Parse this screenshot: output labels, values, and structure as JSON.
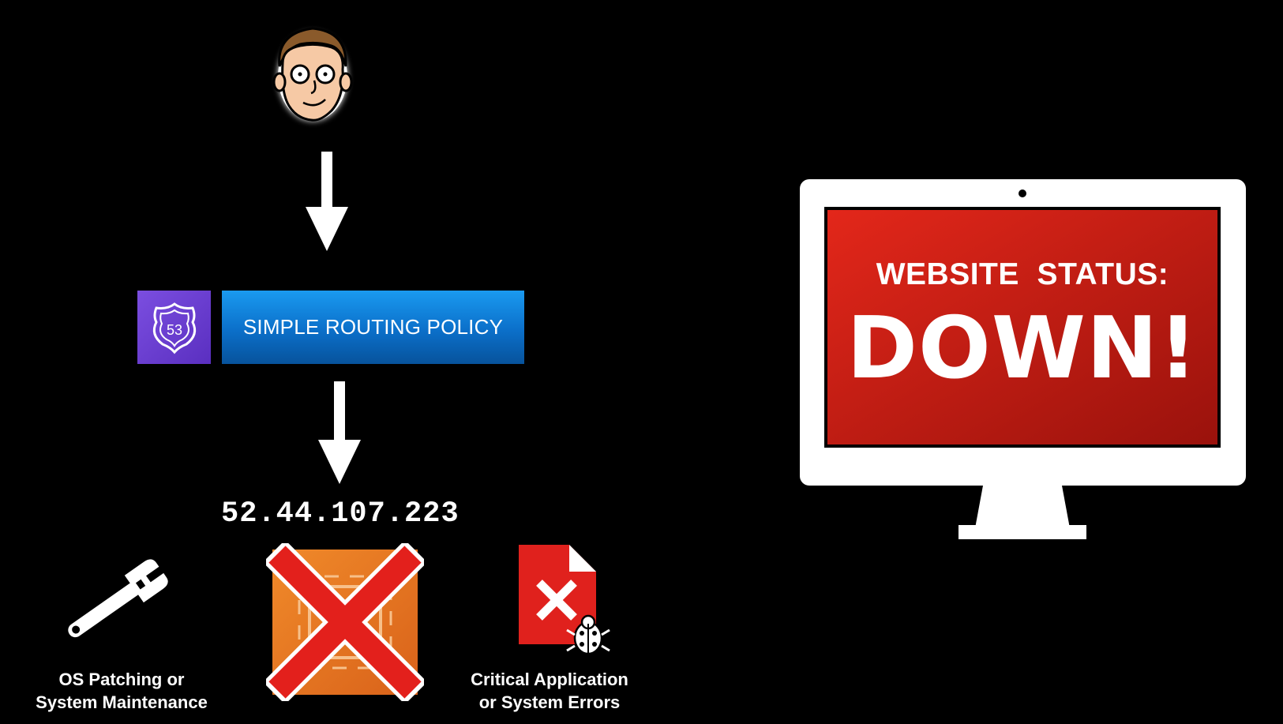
{
  "routing_policy": {
    "label": "SIMPLE ROUTING POLICY",
    "badge_number": "53"
  },
  "ip_address": "52.44.107.223",
  "causes": [
    {
      "label_line1": "OS Patching or",
      "label_line2": "System Maintenance",
      "icon": "wrench-icon"
    },
    {
      "label_line1": "Critical Application",
      "label_line2": "or System Errors",
      "icon": "error-document-icon"
    }
  ],
  "server": {
    "icon": "ec2-instance-icon",
    "state": "failed"
  },
  "monitor": {
    "status_label": "WEBSITE  STATUS:",
    "status_value": "DOWN!"
  },
  "colors": {
    "policy_blue": "#0b7fd6",
    "route53_purple": "#6a3fd0",
    "ec2_orange": "#e8761c",
    "error_red": "#e0211d",
    "screen_red": "#c41a12"
  }
}
